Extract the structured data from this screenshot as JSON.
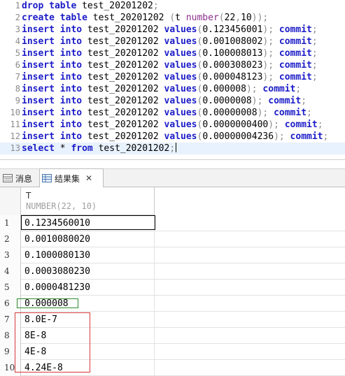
{
  "editor": {
    "lines": [
      {
        "n": "1",
        "tokens": [
          {
            "t": "kw",
            "v": "drop"
          },
          {
            "t": "ident",
            "v": " "
          },
          {
            "t": "kw",
            "v": "table"
          },
          {
            "t": "ident",
            "v": " test_20201202"
          },
          {
            "t": "punc",
            "v": ";"
          }
        ]
      },
      {
        "n": "2",
        "tokens": [
          {
            "t": "kw",
            "v": "create"
          },
          {
            "t": "ident",
            "v": " "
          },
          {
            "t": "kw",
            "v": "table"
          },
          {
            "t": "ident",
            "v": " test_20201202 "
          },
          {
            "t": "punc",
            "v": "("
          },
          {
            "t": "ident",
            "v": "t "
          },
          {
            "t": "fn",
            "v": "number"
          },
          {
            "t": "punc",
            "v": "("
          },
          {
            "t": "num",
            "v": "22"
          },
          {
            "t": "punc",
            "v": ","
          },
          {
            "t": "num",
            "v": "10"
          },
          {
            "t": "punc",
            "v": "));"
          }
        ]
      },
      {
        "n": "3",
        "tokens": [
          {
            "t": "kw",
            "v": "insert"
          },
          {
            "t": "ident",
            "v": " "
          },
          {
            "t": "kw",
            "v": "into"
          },
          {
            "t": "ident",
            "v": " test_20201202 "
          },
          {
            "t": "kw",
            "v": "values"
          },
          {
            "t": "punc",
            "v": "("
          },
          {
            "t": "num",
            "v": "0.123456001"
          },
          {
            "t": "punc",
            "v": "); "
          },
          {
            "t": "kw",
            "v": "commit"
          },
          {
            "t": "punc",
            "v": ";"
          }
        ]
      },
      {
        "n": "4",
        "tokens": [
          {
            "t": "kw",
            "v": "insert"
          },
          {
            "t": "ident",
            "v": " "
          },
          {
            "t": "kw",
            "v": "into"
          },
          {
            "t": "ident",
            "v": " test_20201202 "
          },
          {
            "t": "kw",
            "v": "values"
          },
          {
            "t": "punc",
            "v": "("
          },
          {
            "t": "num",
            "v": "0.001008002"
          },
          {
            "t": "punc",
            "v": "); "
          },
          {
            "t": "kw",
            "v": "commit"
          },
          {
            "t": "punc",
            "v": ";"
          }
        ]
      },
      {
        "n": "5",
        "tokens": [
          {
            "t": "kw",
            "v": "insert"
          },
          {
            "t": "ident",
            "v": " "
          },
          {
            "t": "kw",
            "v": "into"
          },
          {
            "t": "ident",
            "v": " test_20201202 "
          },
          {
            "t": "kw",
            "v": "values"
          },
          {
            "t": "punc",
            "v": "("
          },
          {
            "t": "num",
            "v": "0.100008013"
          },
          {
            "t": "punc",
            "v": "); "
          },
          {
            "t": "kw",
            "v": "commit"
          },
          {
            "t": "punc",
            "v": ";"
          }
        ]
      },
      {
        "n": "6",
        "tokens": [
          {
            "t": "kw",
            "v": "insert"
          },
          {
            "t": "ident",
            "v": " "
          },
          {
            "t": "kw",
            "v": "into"
          },
          {
            "t": "ident",
            "v": " test_20201202 "
          },
          {
            "t": "kw",
            "v": "values"
          },
          {
            "t": "punc",
            "v": "("
          },
          {
            "t": "num",
            "v": "0.000308023"
          },
          {
            "t": "punc",
            "v": "); "
          },
          {
            "t": "kw",
            "v": "commit"
          },
          {
            "t": "punc",
            "v": ";"
          }
        ]
      },
      {
        "n": "7",
        "tokens": [
          {
            "t": "kw",
            "v": "insert"
          },
          {
            "t": "ident",
            "v": " "
          },
          {
            "t": "kw",
            "v": "into"
          },
          {
            "t": "ident",
            "v": " test_20201202 "
          },
          {
            "t": "kw",
            "v": "values"
          },
          {
            "t": "punc",
            "v": "("
          },
          {
            "t": "num",
            "v": "0.000048123"
          },
          {
            "t": "punc",
            "v": "); "
          },
          {
            "t": "kw",
            "v": "commit"
          },
          {
            "t": "punc",
            "v": ";"
          }
        ]
      },
      {
        "n": "8",
        "tokens": [
          {
            "t": "kw",
            "v": "insert"
          },
          {
            "t": "ident",
            "v": " "
          },
          {
            "t": "kw",
            "v": "into"
          },
          {
            "t": "ident",
            "v": " test_20201202 "
          },
          {
            "t": "kw",
            "v": "values"
          },
          {
            "t": "punc",
            "v": "("
          },
          {
            "t": "num",
            "v": "0.000008"
          },
          {
            "t": "punc",
            "v": "); "
          },
          {
            "t": "kw",
            "v": "commit"
          },
          {
            "t": "punc",
            "v": ";"
          }
        ]
      },
      {
        "n": "9",
        "tokens": [
          {
            "t": "kw",
            "v": "insert"
          },
          {
            "t": "ident",
            "v": " "
          },
          {
            "t": "kw",
            "v": "into"
          },
          {
            "t": "ident",
            "v": " test_20201202 "
          },
          {
            "t": "kw",
            "v": "values"
          },
          {
            "t": "punc",
            "v": "("
          },
          {
            "t": "num",
            "v": "0.0000008"
          },
          {
            "t": "punc",
            "v": "); "
          },
          {
            "t": "kw",
            "v": "commit"
          },
          {
            "t": "punc",
            "v": ";"
          }
        ]
      },
      {
        "n": "10",
        "tokens": [
          {
            "t": "kw",
            "v": "insert"
          },
          {
            "t": "ident",
            "v": " "
          },
          {
            "t": "kw",
            "v": "into"
          },
          {
            "t": "ident",
            "v": " test_20201202 "
          },
          {
            "t": "kw",
            "v": "values"
          },
          {
            "t": "punc",
            "v": "("
          },
          {
            "t": "num",
            "v": "0.00000008"
          },
          {
            "t": "punc",
            "v": "); "
          },
          {
            "t": "kw",
            "v": "commit"
          },
          {
            "t": "punc",
            "v": ";"
          }
        ]
      },
      {
        "n": "11",
        "tokens": [
          {
            "t": "kw",
            "v": "insert"
          },
          {
            "t": "ident",
            "v": " "
          },
          {
            "t": "kw",
            "v": "into"
          },
          {
            "t": "ident",
            "v": " test_20201202 "
          },
          {
            "t": "kw",
            "v": "values"
          },
          {
            "t": "punc",
            "v": "("
          },
          {
            "t": "num",
            "v": "0.0000000400"
          },
          {
            "t": "punc",
            "v": "); "
          },
          {
            "t": "kw",
            "v": "commit"
          },
          {
            "t": "punc",
            "v": ";"
          }
        ]
      },
      {
        "n": "12",
        "tokens": [
          {
            "t": "kw",
            "v": "insert"
          },
          {
            "t": "ident",
            "v": " "
          },
          {
            "t": "kw",
            "v": "into"
          },
          {
            "t": "ident",
            "v": " test_20201202 "
          },
          {
            "t": "kw",
            "v": "values"
          },
          {
            "t": "punc",
            "v": "("
          },
          {
            "t": "num",
            "v": "0.00000004236"
          },
          {
            "t": "punc",
            "v": "); "
          },
          {
            "t": "kw",
            "v": "commit"
          },
          {
            "t": "punc",
            "v": ";"
          }
        ]
      },
      {
        "n": "13",
        "current": true,
        "tokens": [
          {
            "t": "kw",
            "v": "select"
          },
          {
            "t": "ident",
            "v": " * "
          },
          {
            "t": "kw",
            "v": "from"
          },
          {
            "t": "ident",
            "v": " test_20201202"
          },
          {
            "t": "punc",
            "v": ";"
          }
        ]
      }
    ]
  },
  "tabs": {
    "messages_label": "消息",
    "results_label": "结果集",
    "close_glyph": "✕",
    "messages_icon": "table-icon",
    "results_icon": "grid-icon"
  },
  "grid": {
    "column": {
      "name": "T",
      "type": "NUMBER(22, 10)"
    },
    "rows": [
      {
        "n": "1",
        "value": "0.1234560010"
      },
      {
        "n": "2",
        "value": "0.0010080020"
      },
      {
        "n": "3",
        "value": "0.1000080130"
      },
      {
        "n": "4",
        "value": "0.0003080230"
      },
      {
        "n": "5",
        "value": "0.0000481230"
      },
      {
        "n": "6",
        "value": "0.000008"
      },
      {
        "n": "7",
        "value": "8.0E-7"
      },
      {
        "n": "8",
        "value": "8E-8"
      },
      {
        "n": "9",
        "value": "4E-8"
      },
      {
        "n": "10",
        "value": "4.24E-8"
      }
    ]
  },
  "colors": {
    "keyword": "#1c1cc8",
    "highlight_green": "#2e8b2e",
    "highlight_red": "#d63a3a",
    "current_line": "#e8f2fe"
  }
}
